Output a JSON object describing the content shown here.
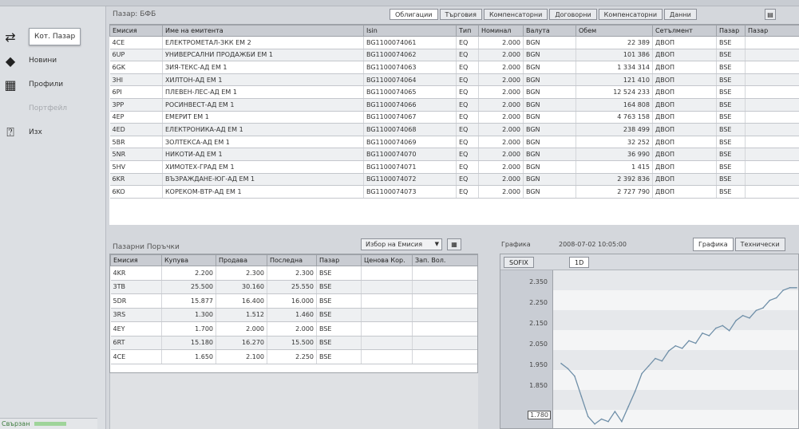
{
  "sidebar": {
    "items": [
      {
        "label": "Кот. Пазар",
        "icon": "market-icon",
        "glyph": "⇄",
        "active": true
      },
      {
        "label": "Новини",
        "icon": "news-icon",
        "glyph": "◆",
        "active": false
      },
      {
        "label": "Профили",
        "icon": "profile-icon",
        "glyph": "▦",
        "active": false
      },
      {
        "label": "Портфейл",
        "icon": "portfolio-icon",
        "glyph": "",
        "disabled": true
      },
      {
        "label": "Изх",
        "icon": "exit-icon",
        "glyph": "⍰",
        "active": false
      }
    ],
    "status": "Свързан"
  },
  "instruments": {
    "title": "Пазар: БФБ",
    "tabs": [
      "Облигации",
      "Търговия",
      "Компенсаторни",
      "Договорни",
      "Компенсаторни",
      "Данни"
    ],
    "columns": [
      "Емисия",
      "Име на емитента",
      "Isin",
      "Тип",
      "Номинал",
      "Валута",
      "Обем",
      "Сетълмент",
      "Пазар",
      "Пазар"
    ],
    "rows": [
      [
        "4CE",
        "ЕЛЕКТРОМЕТАЛ-ЗКК   ЕМ 2",
        "BG1100074061",
        "EQ",
        "2.000",
        "BGN",
        "22 389",
        "ДВОП",
        "BSE"
      ],
      [
        "6UP",
        "УНИВЕРСАЛНИ ПРОДАЖБИ ЕМ 1",
        "BG1100074062",
        "EQ",
        "2.000",
        "BGN",
        "101 386",
        "ДВОП",
        "BSE"
      ],
      [
        "6GK",
        "ЗИЯ-ТЕКС-АД   ЕМ 1",
        "BG1100074063",
        "EQ",
        "2.000",
        "BGN",
        "1 334 314",
        "ДВОП",
        "BSE"
      ],
      [
        "3HI",
        "ХИЛТОН-АД   ЕМ 1",
        "BG1100074064",
        "EQ",
        "2.000",
        "BGN",
        "121 410",
        "ДВОП",
        "BSE"
      ],
      [
        "6PI",
        "ПЛЕВЕН-ЛЕС-АД   ЕМ 1",
        "BG1100074065",
        "EQ",
        "2.000",
        "BGN",
        "12 524 233",
        "ДВОП",
        "BSE"
      ],
      [
        "3PP",
        "РОСИНВЕСТ-АД   ЕМ 1",
        "BG1100074066",
        "EQ",
        "2.000",
        "BGN",
        "164 808",
        "ДВОП",
        "BSE"
      ],
      [
        "4EP",
        "ЕМЕРИТ   ЕМ 1",
        "BG1100074067",
        "EQ",
        "2.000",
        "BGN",
        "4 763 158",
        "ДВОП",
        "BSE"
      ],
      [
        "4ED",
        "ЕЛЕКТРОНИКА-АД   ЕМ 1",
        "BG1100074068",
        "EQ",
        "2.000",
        "BGN",
        "238 499",
        "ДВОП",
        "BSE"
      ],
      [
        "5BR",
        "ЗОЛТЕКСА-АД   ЕМ 1",
        "BG1100074069",
        "EQ",
        "2.000",
        "BGN",
        "32 252",
        "ДВОП",
        "BSE"
      ],
      [
        "5NR",
        "НИКОТИ-АД   ЕМ 1",
        "BG1100074070",
        "EQ",
        "2.000",
        "BGN",
        "36 990",
        "ДВОП",
        "BSE"
      ],
      [
        "5HV",
        "ХИМОТЕХ-ГРАД   ЕМ 1",
        "BG1100074071",
        "EQ",
        "2.000",
        "BGN",
        "1 415",
        "ДВОП",
        "BSE"
      ],
      [
        "6KR",
        "ВЪЗРАЖДАНЕ-ЮГ-АД   ЕМ 1",
        "BG1100074072",
        "EQ",
        "2.000",
        "BGN",
        "2 392 836",
        "ДВОП",
        "BSE"
      ],
      [
        "6KO",
        "КОРЕКОМ-ВТР-АД   ЕМ 1",
        "BG1100074073",
        "EQ",
        "2.000",
        "BGN",
        "2 727 790",
        "ДВОП",
        "BSE"
      ]
    ]
  },
  "quotes": {
    "title": "Пазарни Поръчки",
    "dropdown": "Избор на Емисия",
    "columns": [
      "Емисия",
      "Купува",
      "Продава",
      "Последна",
      "Пазар",
      "Ценова Кор.",
      "Зап. Вол."
    ],
    "rows": [
      [
        "4KR",
        "2.200",
        "2.300",
        "2.300",
        "BSE"
      ],
      [
        "3TB",
        "25.500",
        "30.160",
        "25.550",
        "BSE"
      ],
      [
        "5DR",
        "15.877",
        "16.400",
        "16.000",
        "BSE"
      ],
      [
        "3RS",
        "1.300",
        "1.512",
        "1.460",
        "BSE"
      ],
      [
        "4EY",
        "1.700",
        "2.000",
        "2.000",
        "BSE"
      ],
      [
        "6RT",
        "15.180",
        "16.270",
        "15.500",
        "BSE"
      ],
      [
        "4CE",
        "1.650",
        "2.100",
        "2.250",
        "BSE"
      ]
    ]
  },
  "chart": {
    "title": "Графика",
    "timestamp": "2008-07-02 10:05:00",
    "tabs": [
      "Графика",
      "Технически"
    ],
    "mini_tabs": [
      "SOFIX",
      "1D"
    ],
    "y_ticks": [
      "2.350",
      "2.250",
      "2.150",
      "2.050",
      "1.950",
      "1.850",
      "1.780"
    ],
    "selected_tick": "1.780",
    "chart_data": {
      "type": "line",
      "yrange": [
        1.78,
        2.38
      ],
      "series": [
        {
          "values": [
            2.03,
            2.01,
            1.98,
            1.9,
            1.82,
            1.79,
            1.81,
            1.8,
            1.84,
            1.8,
            1.86,
            1.92,
            1.99,
            2.02,
            2.05,
            2.04,
            2.08,
            2.1,
            2.09,
            2.12,
            2.11,
            2.15,
            2.14,
            2.17,
            2.18,
            2.16,
            2.2,
            2.22,
            2.21,
            2.24,
            2.25,
            2.28,
            2.29,
            2.32,
            2.33,
            2.33
          ]
        }
      ]
    }
  }
}
